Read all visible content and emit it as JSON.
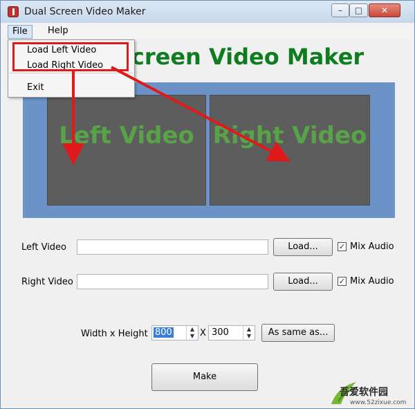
{
  "window": {
    "title": "Dual Screen Video Maker",
    "minimize_glyph": "–",
    "maximize_glyph": "□",
    "close_glyph": "✕"
  },
  "menubar": {
    "file": "File",
    "help": "Help"
  },
  "file_menu": {
    "items": [
      "Load Left Video",
      "Load Right Video",
      "Exit"
    ]
  },
  "headline": "Dual Screen Video Maker",
  "preview": {
    "left_text": "Left Video",
    "right_text": "Right Video"
  },
  "left_video": {
    "label": "Left Video",
    "value": "",
    "load_button": "Load...",
    "mix_audio_label": "Mix Audio",
    "mix_audio_checked": true
  },
  "right_video": {
    "label": "Right Video",
    "value": "",
    "load_button": "Load...",
    "mix_audio_label": "Mix Audio",
    "mix_audio_checked": true
  },
  "size": {
    "label": "Width x Height",
    "width": "800",
    "separator": "X",
    "height": "300",
    "same_button": "As same as..."
  },
  "make_button": "Make",
  "watermark": {
    "text": "吾爱软件园",
    "url": "www.52zixue.com"
  },
  "colors": {
    "headline": "#0f7d1f",
    "preview_bg": "#6b93c8",
    "pane_bg": "#5d5d5d",
    "annotation": "#e01a1a"
  }
}
